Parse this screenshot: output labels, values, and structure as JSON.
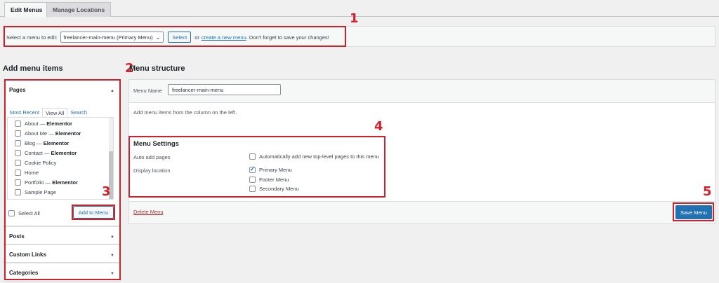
{
  "tabs": [
    {
      "label": "Edit Menus",
      "active": true
    },
    {
      "label": "Manage Locations",
      "active": false
    }
  ],
  "menu_select": {
    "label": "Select a menu to edit:",
    "selected": "freelancer-main-menu (Primary Menu)",
    "select_button": "Select",
    "or_text": "or",
    "create_link": "create a new menu",
    "reminder": ". Don't forget to save your changes!"
  },
  "annotations": [
    "1",
    "2",
    "3",
    "4",
    "5"
  ],
  "add_items": {
    "heading": "Add menu items",
    "pages": {
      "title": "Pages",
      "subtabs": [
        "Most Recent",
        "View All",
        "Search"
      ],
      "active_subtab": "View All",
      "items": [
        {
          "label": "About",
          "suffix": "Elementor"
        },
        {
          "label": "About Me",
          "suffix": "Elementor"
        },
        {
          "label": "Blog",
          "suffix": "Elementor"
        },
        {
          "label": "Contact",
          "suffix": "Elementor"
        },
        {
          "label": "Cookie Policy",
          "suffix": ""
        },
        {
          "label": "Home",
          "suffix": ""
        },
        {
          "label": "Portfolio",
          "suffix": "Elementor"
        },
        {
          "label": "Sample Page",
          "suffix": ""
        }
      ],
      "select_all": "Select All",
      "add_button": "Add to Menu"
    },
    "other_sections": [
      "Posts",
      "Custom Links",
      "Categories"
    ]
  },
  "menu_structure": {
    "heading": "Menu structure",
    "name_label": "Menu Name",
    "name_value": "freelancer-main-menu",
    "instructions": "Add menu items from the column on the left.",
    "settings": {
      "title": "Menu Settings",
      "auto_add_label": "Auto add pages",
      "auto_add_option": "Automatically add new top-level pages to this menu",
      "display_label": "Display location",
      "locations": [
        {
          "label": "Primary Menu",
          "checked": true
        },
        {
          "label": "Footer Menu",
          "checked": false
        },
        {
          "label": "Secondary Menu",
          "checked": false
        }
      ]
    },
    "delete_link": "Delete Menu",
    "save_button": "Save Menu"
  },
  "colors": {
    "accent": "#2271b1",
    "annotation": "#d2202a",
    "delete": "#b32d2e"
  }
}
